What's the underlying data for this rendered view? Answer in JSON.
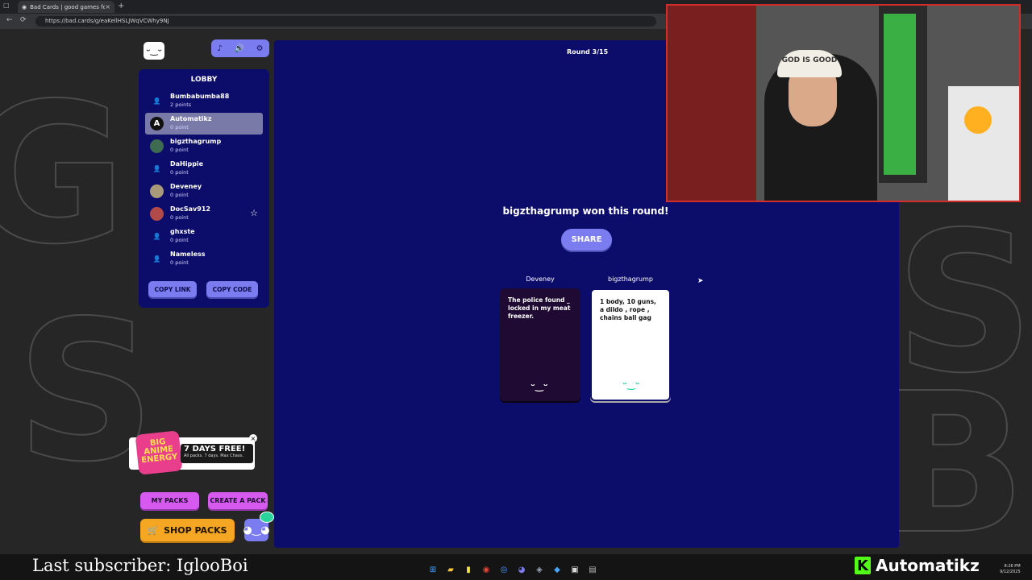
{
  "browser": {
    "tab_title": "Bad Cards | good games fo",
    "tab_close": "×",
    "new_tab": "+",
    "url": "https://bad.cards/g/eaKellHSLJWqVCWhy9NJ",
    "back": "←",
    "reload": "⟳"
  },
  "controls": {
    "music_icon": "♪",
    "volume_icon": "🔊",
    "settings_icon": "⚙"
  },
  "lobby": {
    "title": "LOBBY",
    "players": [
      {
        "name": "Bumbabumba88",
        "points": "2 points",
        "avatar": "user-icon"
      },
      {
        "name": "Automatikz",
        "points": "0 point",
        "avatar": "A",
        "active": true
      },
      {
        "name": "bigzthagrump",
        "points": "0 point",
        "avatar": "image"
      },
      {
        "name": "DaHippie",
        "points": "0 point",
        "avatar": "user-icon"
      },
      {
        "name": "Deveney",
        "points": "0 point",
        "avatar": "image"
      },
      {
        "name": "DocSav912",
        "points": "0 point",
        "avatar": "image",
        "star": "☆"
      },
      {
        "name": "ghxste",
        "points": "0 point",
        "avatar": "user-icon"
      },
      {
        "name": "Nameless",
        "points": "0 point",
        "avatar": "user-icon"
      }
    ],
    "copy_link": "COPY LINK",
    "copy_code": "COPY CODE"
  },
  "promo": {
    "title": "7 DAYS FREE!",
    "subtitle": "All packs. 7 days. Max Chaos.",
    "close": "×"
  },
  "buttons": {
    "my_packs": "MY PACKS",
    "create_pack": "CREATE A PACK",
    "shop_packs": "SHOP PACKS"
  },
  "game": {
    "round": "Round 3/15",
    "winner_text": "bigzthagrump won this round!",
    "share": "SHARE",
    "black_card": {
      "owner": "Deveney",
      "text": "The police found _ locked in my meat freezer."
    },
    "white_card": {
      "owner": "bigzthagrump",
      "text": "1 body, 10 guns, a dildo , rope , chains ball gag"
    }
  },
  "webcam": {
    "hat_text": "GOD IS GOOD"
  },
  "overlay": {
    "last_subscriber": "Last subscriber: IglooBoi",
    "streamer": "Automatikz",
    "time": "8:26 PM",
    "date": "9/12/2025"
  }
}
